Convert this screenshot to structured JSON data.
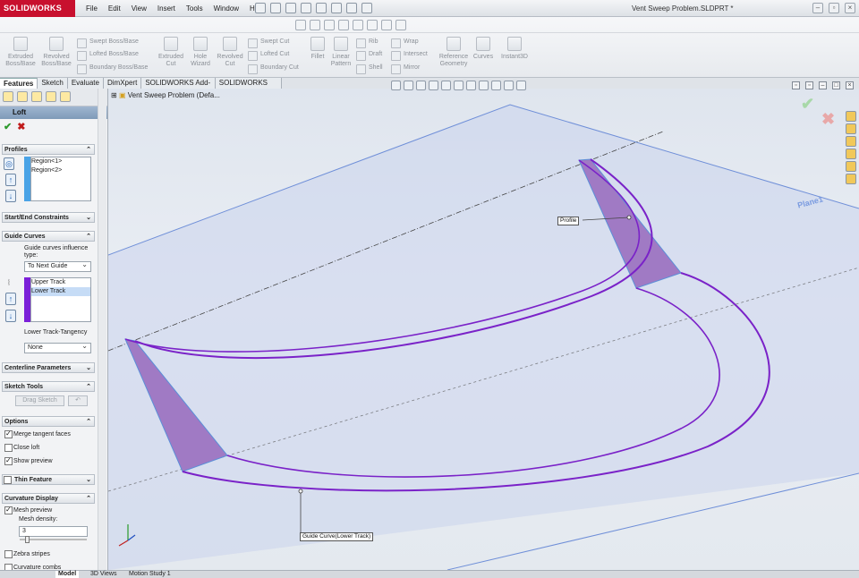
{
  "app": {
    "logo": "SOLIDWORKS",
    "document_title": "Vent Sweep Problem.SLDPRT *"
  },
  "menu": [
    "File",
    "Edit",
    "View",
    "Insert",
    "Tools",
    "Window",
    "Help"
  ],
  "commands": {
    "extruded_boss": "Extruded Boss/Base",
    "revolved_boss": "Revolved Boss/Base",
    "swept_boss": "Swept Boss/Base",
    "lofted_boss": "Lofted Boss/Base",
    "boundary_boss": "Boundary Boss/Base",
    "extruded_cut": "Extruded Cut",
    "hole_wizard": "Hole Wizard",
    "revolved_cut": "Revolved Cut",
    "swept_cut": "Swept Cut",
    "lofted_cut": "Lofted Cut",
    "boundary_cut": "Boundary Cut",
    "fillet": "Fillet",
    "linear_pattern": "Linear Pattern",
    "rib": "Rib",
    "draft": "Draft",
    "shell": "Shell",
    "wrap": "Wrap",
    "intersect": "Intersect",
    "mirror": "Mirror",
    "reference_geometry": "Reference Geometry",
    "curves": "Curves",
    "instant3d": "Instant3D"
  },
  "tabs": [
    "Features",
    "Sketch",
    "Evaluate",
    "DimXpert",
    "SOLIDWORKS Add-Ins",
    "SOLIDWORKS MBD"
  ],
  "property_manager": {
    "title": "Loft",
    "help": "?",
    "profiles": {
      "header": "Profiles",
      "items": [
        "Region<1>",
        "Region<2>"
      ]
    },
    "start_end": "Start/End Constraints",
    "guide_curves": {
      "header": "Guide Curves",
      "influence_label": "Guide curves influence type:",
      "influence_value": "To Next Guide",
      "items": [
        "Upper Track",
        "Lower Track"
      ],
      "tangency_label": "Lower Track-Tangency",
      "tangency_value": "None"
    },
    "centerline": "Centerline Parameters",
    "sketch_tools": {
      "header": "Sketch Tools",
      "drag_sketch": "Drag Sketch"
    },
    "options": {
      "header": "Options",
      "merge_tangent": "Merge tangent faces",
      "close_loft": "Close loft",
      "show_preview": "Show preview"
    },
    "thin_feature": "Thin Feature",
    "curvature_display": {
      "header": "Curvature Display",
      "mesh_preview": "Mesh preview",
      "mesh_density_label": "Mesh density:",
      "mesh_density": "3",
      "zebra": "Zebra stripes",
      "curvature_combs": "Curvature combs"
    }
  },
  "graphics": {
    "tree_item": "Vent Sweep Problem (Defa...",
    "plane_label": "Plane1",
    "profile_callout": "Profile",
    "guide_callout": "Guide Curve(Lower Track)"
  },
  "bottom_tabs": [
    "Model",
    "3D Views",
    "Motion Study 1"
  ],
  "colors": {
    "profile_fill": "#a07ac4",
    "guide_curve": "#7a22c8",
    "plane_edge": "#6f8fd8",
    "plane_fill": "#c9d2ee"
  }
}
